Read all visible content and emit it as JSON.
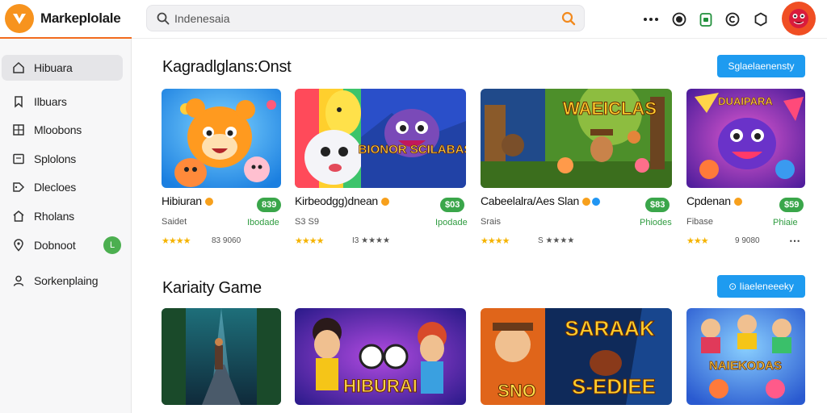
{
  "app": {
    "brand": "Markeplolale"
  },
  "search": {
    "value": "Indenesaia"
  },
  "sidebar": {
    "items": [
      {
        "label": "Hibuara",
        "icon": "home-icon"
      },
      {
        "label": "Ilbuars",
        "icon": "bookmark-icon"
      },
      {
        "label": "Mloobons",
        "icon": "grid-icon"
      },
      {
        "label": "Splolons",
        "icon": "box-icon"
      },
      {
        "label": "Dlecloes",
        "icon": "tag-icon"
      },
      {
        "label": "Rholans",
        "icon": "house-icon"
      },
      {
        "label": "Dobnoot",
        "icon": "pin-icon",
        "badge": "L"
      },
      {
        "label": "Sorkenplaing",
        "icon": "user-icon"
      }
    ]
  },
  "section1": {
    "title": "Kagradlglans:Onst",
    "button": "Sglaelaenensty",
    "cards": [
      {
        "title": "Hibiuran",
        "price": "839",
        "meta": "Saidet",
        "tag": "Ibodade",
        "stars": "★★★★",
        "reviews": "83 9060",
        "art": "bear"
      },
      {
        "title": "Kirbeodgg)dnean",
        "price": "$03",
        "meta": "S3 S9",
        "tag": "Ipodade",
        "stars": "★★★★",
        "reviews": "I3 ★★★★",
        "art": "pets"
      },
      {
        "title": "Cabeelalra/Aes Slan",
        "price": "$83",
        "meta": "Srais",
        "tag": "Phiodes",
        "stars": "★★★★",
        "reviews": "S ★★★★",
        "art": "forest"
      },
      {
        "title": "Cpdenan",
        "price": "$59",
        "meta": "Fibase",
        "tag": "Phiaie",
        "stars": "★★★",
        "reviews": "9 9080",
        "art": "monster"
      }
    ]
  },
  "section2": {
    "title": "Kariaity Game",
    "button": "⊙ Iiaeleneeeky",
    "cards": [
      {
        "art": "jungle"
      },
      {
        "art": "hibiura"
      },
      {
        "art": "sabaak"
      },
      {
        "art": "naiekodas"
      }
    ]
  },
  "art": {
    "bear_text": "",
    "pets_text": "BIONOR SCILABAS",
    "forest_text": "WAEICLAS",
    "monster_text": "DUAIPARA",
    "hibiura_text": "HIBURAI",
    "sabaak_text": "SARAAK",
    "sabaak_sub": "S-EDIEE",
    "naiekodas_text": "NAIEKODAS",
    "snd_text": "SNO"
  }
}
